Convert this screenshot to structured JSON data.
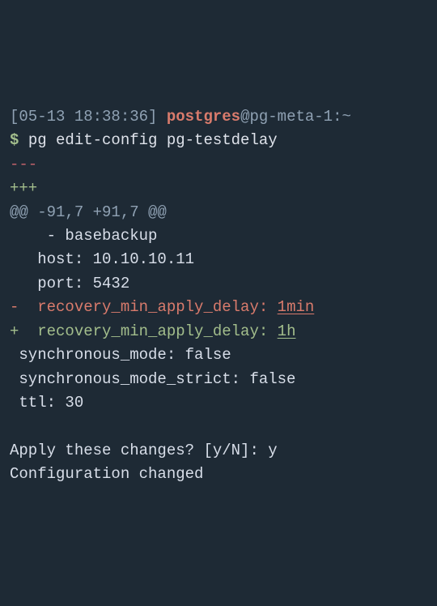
{
  "prompt": {
    "timestamp": "[05-13 18:38:36]",
    "user": "postgres",
    "sep1": "@",
    "host": "pg-meta-1",
    "sep2": ":",
    "path": "~",
    "symbol": "$",
    "command": "pg edit-config pg-testdelay"
  },
  "diff": {
    "minus_header": "---",
    "plus_header": "+++",
    "hunk": "@@ -91,7 +91,7 @@",
    "ctx1": "    - basebackup",
    "ctx2": "   host: 10.10.10.11",
    "ctx3": "   port: 5432",
    "removed_prefix": "-  ",
    "removed_key": "recovery_min_apply_delay: ",
    "removed_val": "1min",
    "added_prefix": "+  ",
    "added_key": "recovery_min_apply_delay: ",
    "added_val": "1h",
    "ctx4": " synchronous_mode: false",
    "ctx5": " synchronous_mode_strict: false",
    "ctx6": " ttl: 30"
  },
  "confirm": {
    "question": "Apply these changes? [y/N]: ",
    "answer": "y",
    "result": "Configuration changed"
  }
}
